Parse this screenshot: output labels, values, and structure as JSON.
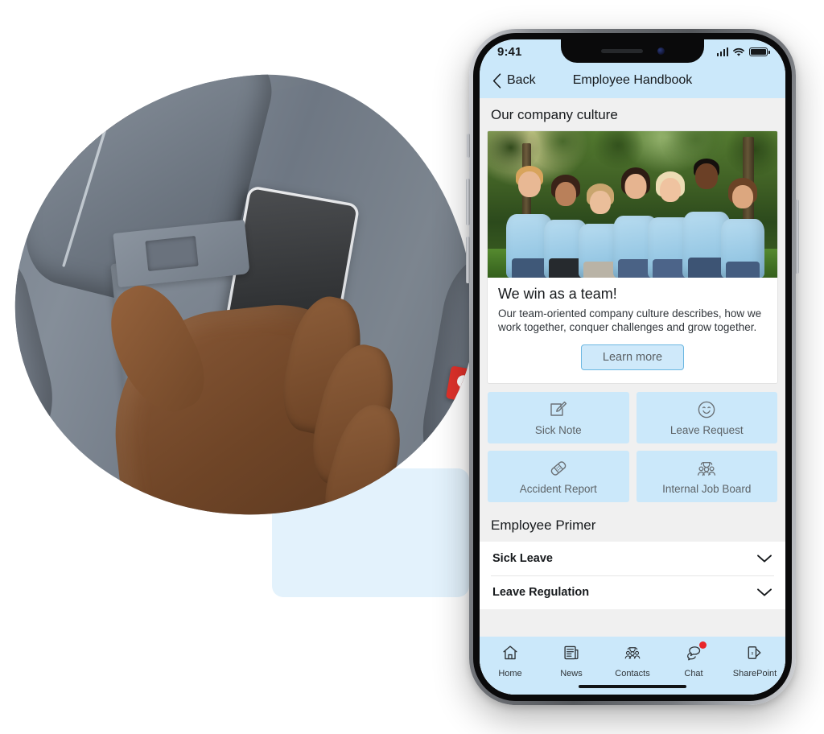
{
  "device": {
    "status_bar": {
      "time": "9:41",
      "signal_icon": "signal-bars-icon",
      "wifi_icon": "wifi-icon",
      "battery_icon": "battery-full-icon"
    },
    "home_indicator": "home-indicator"
  },
  "nav": {
    "back_label": "Back",
    "back_icon": "chevron-left-icon",
    "title": "Employee Handbook"
  },
  "sections": {
    "culture_header": "Our company culture",
    "primer_header": "Employee Primer"
  },
  "culture_card": {
    "image_alt": "team-photo",
    "title": "We win as a team!",
    "description": "Our team-oriented company culture describes, how we work together, conquer challenges and grow together.",
    "cta_label": "Learn more"
  },
  "tiles": [
    {
      "label": "Sick Note",
      "icon": "edit-document-icon"
    },
    {
      "label": "Leave Request",
      "icon": "smiley-face-icon"
    },
    {
      "label": "Accident Report",
      "icon": "plaster-bandage-icon"
    },
    {
      "label": "Internal Job Board",
      "icon": "people-group-icon"
    }
  ],
  "accordion": [
    {
      "label": "Sick Leave",
      "icon": "chevron-down-icon"
    },
    {
      "label": "Leave Regulation",
      "icon": "chevron-down-icon"
    }
  ],
  "tabs": [
    {
      "label": "Home",
      "icon": "home-icon",
      "badge": false
    },
    {
      "label": "News",
      "icon": "newspaper-icon",
      "badge": false
    },
    {
      "label": "Contacts",
      "icon": "contacts-group-icon",
      "badge": false
    },
    {
      "label": "Chat",
      "icon": "chat-bubbles-icon",
      "badge": true
    },
    {
      "label": "SharePoint",
      "icon": "sharepoint-icon",
      "badge": false
    }
  ],
  "colors": {
    "brand_light_blue": "#cbe8fa",
    "pale_blue_card": "#e3f2fc",
    "section_grey": "#f0f0f0",
    "badge_red": "#e8262a",
    "cta_border": "#6bb7e2"
  }
}
